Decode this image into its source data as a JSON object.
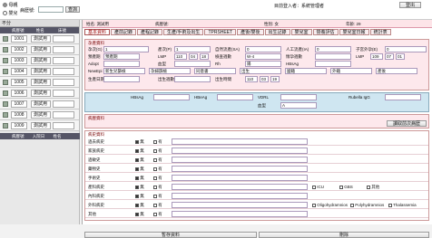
{
  "top": {
    "radio1": "母親",
    "radio2": "嬰兒",
    "bed_label": "病歷號:",
    "search_btn": "查詢",
    "login": "目前登入者：系統管理者",
    "logout": "登出"
  },
  "left": {
    "title": "不分",
    "headers": [
      "病歷號",
      "姓名",
      "床號"
    ],
    "rows": [
      {
        "no": "1001",
        "name": "測試用"
      },
      {
        "no": "1002",
        "name": "測試用"
      },
      {
        "no": "1003",
        "name": "測試用"
      },
      {
        "no": "1004",
        "name": "測試用"
      },
      {
        "no": "1005",
        "name": "測試用"
      },
      {
        "no": "1006",
        "name": "測試用"
      },
      {
        "no": "1007",
        "name": "測試用"
      },
      {
        "no": "1008",
        "name": "測試用"
      },
      {
        "no": "1009",
        "name": "測試用"
      }
    ],
    "second_header": [
      "病歷號",
      "入院日",
      "姓名"
    ]
  },
  "patient": {
    "name_label": "姓名:",
    "name": "測試用",
    "id_label": "病歷號:",
    "sex_label": "性別:",
    "sex": "女",
    "age_label": "年齡:",
    "age": "29"
  },
  "tabs": [
    "基本資料",
    "產前記錄",
    "產程記錄",
    "生產/手術及出生",
    "TPRSHEET",
    "產後/嬰後",
    "出生記錄",
    "嬰兒室",
    "營養評估",
    "嬰兒室日報",
    "統計表"
  ],
  "form": {
    "section1": "孕產資料",
    "g_label": "孕次(G)",
    "g": "1",
    "p_label": "產次(P)",
    "p": "1",
    "ab_label": "自然流產(SA)",
    "ab": "0",
    "ia_label": "人工流產(IA)",
    "ia": "0",
    "ln_label": "子宮外孕(E)",
    "ln": "0",
    "edc_label": "預產期",
    "edc_btn": "預產期",
    "lmp_label": "LMP",
    "lmp": [
      "110",
      "04",
      "18"
    ],
    "exam_label": "檢查週數",
    "exam": "W-4",
    "exam2_label": "LMP",
    "exam2": [
      "109",
      "07",
      "01"
    ],
    "gest_label": "懷孕週數",
    "adopt_label": "Adopt",
    "blood_label": "血型",
    "rh_label": "Rh",
    "rh": "陽",
    "hbs_label": "HBsAg",
    "newborn_label": "NewEpi",
    "row3_items": [
      "新生兒篩檢",
      "孕婦篩檢",
      "同意書",
      "出生",
      "國籍",
      "外籍",
      "產後"
    ],
    "birth_date_label": "生產日期",
    "birth_label": "出生週數",
    "birth_time_label": "出生時間",
    "birth_time": [
      "110",
      "03",
      "19"
    ],
    "section2_left": [
      "HBsAg",
      "HBeAg",
      "VDRL"
    ],
    "section2_right": [
      "Rubella IgG",
      "血型"
    ],
    "blood_type": "A",
    "section3": "病歷資料",
    "disease_btn": "讀取前次病歷",
    "section4": "病史資料",
    "hist_rows": [
      "過去病史",
      "家族病史",
      "過敏史",
      "藥物史",
      "手術史",
      "產科病史",
      "內科病史",
      "外科病史",
      "其他"
    ],
    "na": "Nil",
    "has": "有",
    "none": "無",
    "other_label": "其他",
    "check_labels": [
      "Oligohydramnios",
      "Polyhydramnios",
      "Thalassemia"
    ],
    "extra_labels": [
      "ICU",
      "GBS",
      "其他"
    ],
    "bottom_left": "暫存資料",
    "bottom_right": "刪除"
  }
}
